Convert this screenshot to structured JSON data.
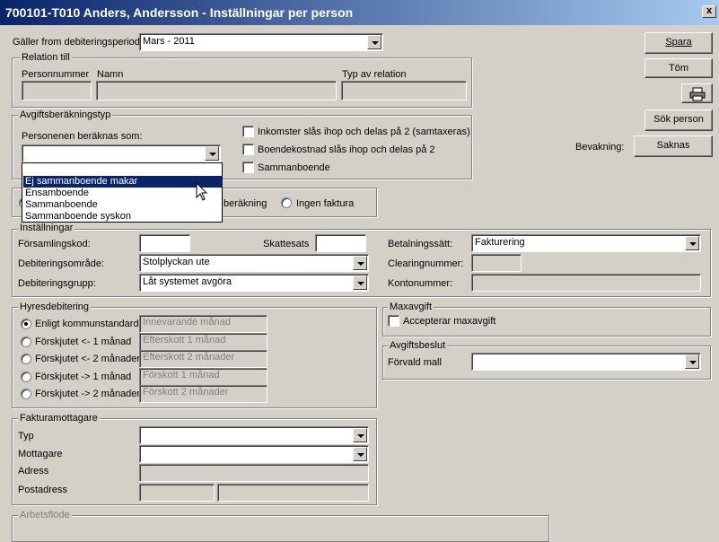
{
  "window": {
    "title": "700101-T010 Anders, Andersson - Inställningar per person",
    "close": "x"
  },
  "period": {
    "label": "Gäller from debiteringsperiod:",
    "value": "Mars - 2011"
  },
  "buttons": {
    "spara": "Spara",
    "tom": "Töm",
    "print_icon": "printer-icon",
    "sok_person": "Sök person"
  },
  "bevakning": {
    "label": "Bevakning:",
    "value": "Saknas"
  },
  "relation": {
    "title": "Relation till",
    "personnummer": "Personnummer",
    "namn": "Namn",
    "typ": "Typ av relation"
  },
  "avgift": {
    "title": "Avgiftsberäkningstyp",
    "beraknas_label": "Personenen beräknas som:",
    "beraknas_value": "",
    "checks": [
      "Inkomster slås ihop och delas på 2 (samtaxeras)",
      "Boendekostnad slås ihop och delas på 2",
      "Sammanboende"
    ],
    "dropdown": {
      "items": [
        "",
        "Ej sammanboende makar",
        "Ensamboende",
        "Sammanboende",
        "Sammanboende syskon"
      ],
      "selected_index": 1
    }
  },
  "calc_radios": {
    "partial_label": "beräkning",
    "ingen": "Ingen faktura"
  },
  "installningar": {
    "title": "Inställningar",
    "forsamlingskod": "Församlingskod:",
    "skattesats": "Skattesats",
    "debiteringsomrade": {
      "label": "Debiteringsområde:",
      "value": "Stolplyckan ute"
    },
    "debiteringsgrupp": {
      "label": "Debiteringsgrupp:",
      "value": "Låt systemet avgöra"
    },
    "betalningssatt": {
      "label": "Betalningssätt:",
      "value": "Fakturering"
    },
    "clearingnummer": "Clearingnummer:",
    "kontonummer": "Kontonummer:"
  },
  "hyres": {
    "title": "Hyresdebitering",
    "options": [
      {
        "label": "Enligt kommunstandard",
        "value": "Innevarande månad",
        "checked": true
      },
      {
        "label": "Förskjutet <- 1 månad",
        "value": "Efterskott 1 månad",
        "checked": false
      },
      {
        "label": "Förskjutet <- 2 månader",
        "value": "Efterskott 2 månader",
        "checked": false
      },
      {
        "label": "Förskjutet -> 1 månad",
        "value": "Förskott 1 månad",
        "checked": false
      },
      {
        "label": "Förskjutet -> 2 månader",
        "value": "Förskott 2 månader",
        "checked": false
      }
    ]
  },
  "maxavgift": {
    "title": "Maxavgift",
    "accepterar": "Accepterar maxavgift"
  },
  "avgiftsbeslut": {
    "title": "Avgiftsbeslut",
    "forvald": "Förvald mall",
    "value": ""
  },
  "faktura": {
    "title": "Fakturamottagare",
    "typ": "Typ",
    "mottagare": "Mottagare",
    "adress": "Adress",
    "postadress": "Postadress"
  },
  "arbetsflode": {
    "title": "Arbetsflöde"
  }
}
